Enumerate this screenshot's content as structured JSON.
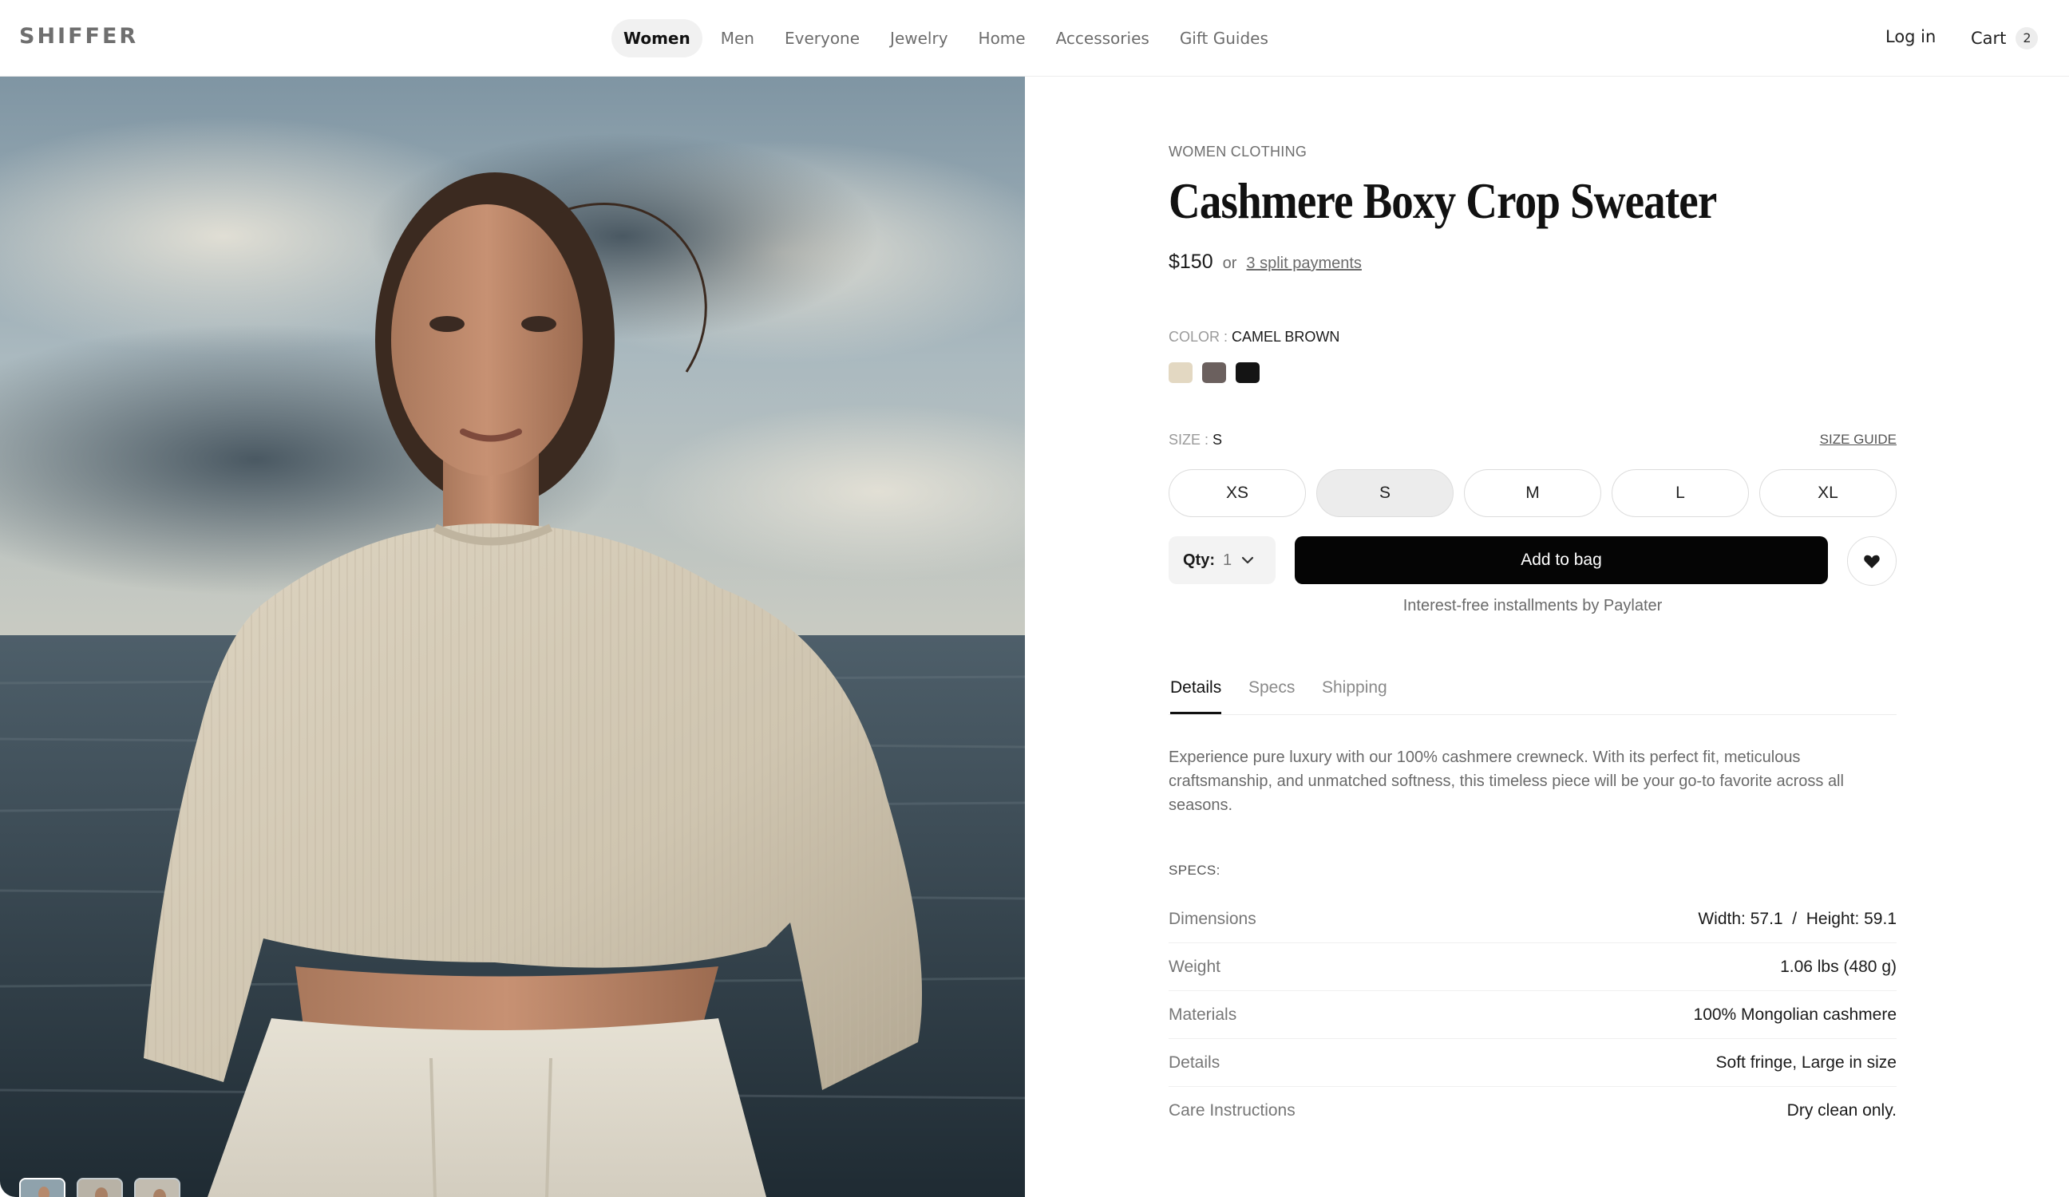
{
  "header": {
    "logo": "SHIFFER",
    "nav": [
      "Women",
      "Men",
      "Everyone",
      "Jewelry",
      "Home",
      "Accessories",
      "Gift Guides"
    ],
    "active_nav": "Women",
    "login": "Log in",
    "cart_label": "Cart",
    "cart_count": "2"
  },
  "product": {
    "category": "WOMEN CLOTHING",
    "title": "Cashmere Boxy Crop Sweater",
    "price": "$150",
    "price_or": "or",
    "split_link": "3 split payments",
    "color_label": "COLOR :",
    "color_value": "CAMEL BROWN",
    "swatches": [
      {
        "name": "cream",
        "hex": "#e3d8c2"
      },
      {
        "name": "taupe",
        "hex": "#6b605e"
      },
      {
        "name": "black",
        "hex": "#141414"
      }
    ],
    "size_label": "SIZE :",
    "size_value": "S",
    "size_guide": "SIZE GUIDE",
    "sizes": [
      "XS",
      "S",
      "M",
      "L",
      "XL"
    ],
    "selected_size": "S",
    "qty_label": "Qty:",
    "qty_value": "1",
    "add_to_bag": "Add to bag",
    "installments": "Interest-free installments by Paylater"
  },
  "tabs": [
    "Details",
    "Specs",
    "Shipping"
  ],
  "active_tab": "Details",
  "description": "Experience pure luxury with our 100% cashmere crewneck. With its perfect fit, meticulous craftsmanship, and unmatched softness, this timeless piece will be your go-to favorite across all seasons.",
  "specs": {
    "label": "SPECS:",
    "rows": [
      {
        "key": "Dimensions",
        "value": "Width: 57.1  /  Height: 59.1"
      },
      {
        "key": "Weight",
        "value": "1.06 lbs (480 g)"
      },
      {
        "key": "Materials",
        "value": "100% Mongolian cashmere"
      },
      {
        "key": "Details",
        "value": "Soft fringe, Large in size"
      },
      {
        "key": "Care Instructions",
        "value": "Dry clean only."
      }
    ]
  },
  "gallery": {
    "thumbnail_count": 3,
    "active_thumbnail": 1
  },
  "colors": {
    "button_black": "#050505",
    "selected_size_bg": "#ececec"
  }
}
